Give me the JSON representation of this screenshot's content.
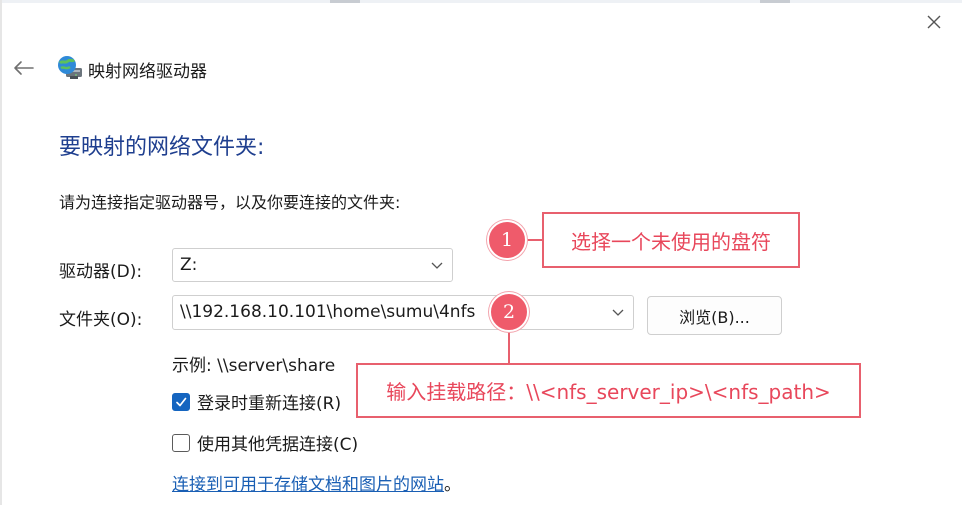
{
  "window": {
    "title": "映射网络驱动器",
    "close_glyph": "✕",
    "back_glyph": "←"
  },
  "heading": "要映射的网络文件夹:",
  "instruction": "请为连接指定驱动器号，以及你要连接的文件夹:",
  "drive": {
    "label": "驱动器(D):",
    "value": "Z:"
  },
  "folder": {
    "label": "文件夹(O):",
    "value": "\\\\192.168.10.101\\home\\sumu\\4nfs",
    "browse_label": "浏览(B)..."
  },
  "example": "示例: \\\\server\\share",
  "reconnect": {
    "label": "登录时重新连接(R)",
    "checked": true
  },
  "credentials": {
    "label": "使用其他凭据连接(C)",
    "checked": false
  },
  "link": {
    "text": "连接到可用于存储文档和图片的网站",
    "suffix": "。"
  },
  "annotations": [
    {
      "number": "1",
      "text": "选择一个未使用的盘符"
    },
    {
      "number": "2",
      "text": "输入挂载路径：\\\\<nfs_server_ip>\\<nfs_path>"
    }
  ],
  "colors": {
    "heading": "#1f3f8f",
    "accent": "#1565c0",
    "link": "#1a5fb4",
    "annotation": "#e8475b",
    "badge": "#ef5b6b"
  },
  "icons": {
    "title": "network-drive-globe-icon",
    "back": "back-arrow-icon",
    "close": "close-icon",
    "dropdown": "chevron-down-icon",
    "check": "checkmark-icon"
  }
}
